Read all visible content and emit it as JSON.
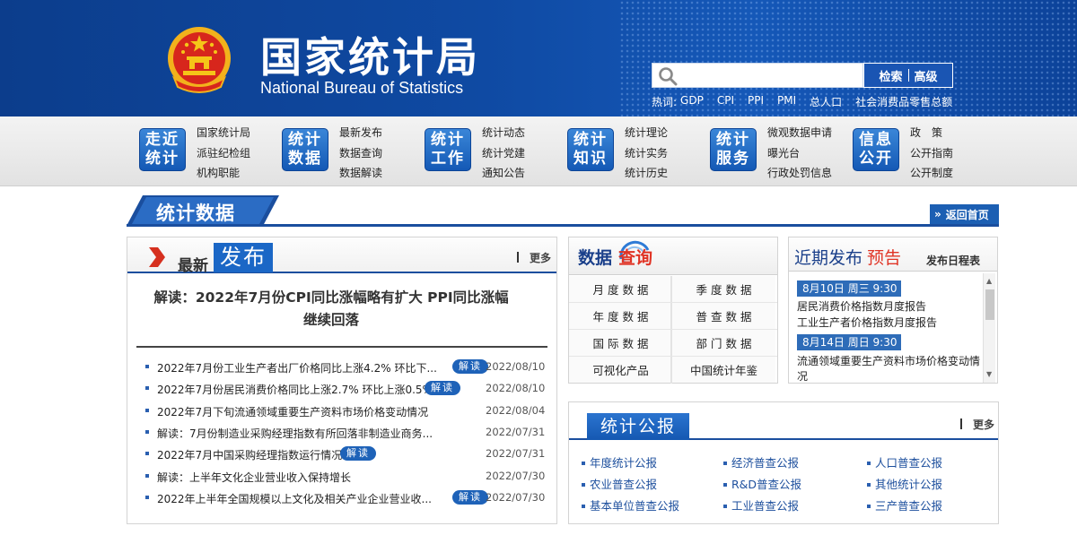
{
  "header": {
    "title": "国家统计局",
    "subtitle": "National Bureau of Statistics",
    "search": {
      "placeholder": "",
      "buttons": [
        "检索",
        "高级"
      ]
    },
    "hot_label": "热词:",
    "hot_words": [
      "GDP",
      "CPI",
      "PPI",
      "PMI",
      "总人口",
      "社会消费品零售总额"
    ]
  },
  "nav": [
    {
      "badge": [
        "走近",
        "统计"
      ],
      "links": [
        "国家统计局",
        "派驻纪检组",
        "机构职能"
      ]
    },
    {
      "badge": [
        "统计",
        "数据"
      ],
      "links": [
        "最新发布",
        "数据查询",
        "数据解读"
      ]
    },
    {
      "badge": [
        "统计",
        "工作"
      ],
      "links": [
        "统计动态",
        "统计党建",
        "通知公告"
      ]
    },
    {
      "badge": [
        "统计",
        "知识"
      ],
      "links": [
        "统计理论",
        "统计实务",
        "统计历史"
      ]
    },
    {
      "badge": [
        "统计",
        "服务"
      ],
      "links": [
        "微观数据申请",
        "曝光台",
        "行政处罚信息"
      ]
    },
    {
      "badge": [
        "信息",
        "公开"
      ],
      "links": [
        "政　策",
        "公开指南",
        "公开制度"
      ]
    }
  ],
  "section": {
    "title": "统计数据",
    "back_home": "返回首页"
  },
  "news": {
    "title_a": "最新",
    "title_b": "发布",
    "more": "更多",
    "headline": "解读：2022年7月份CPI同比涨幅略有扩大 PPI同比涨幅继续回落",
    "tag_label": "解读",
    "items": [
      {
        "text": "2022年7月份工业生产者出厂价格同比上涨4.2% 环比下...",
        "tag": true,
        "date": "2022/08/10"
      },
      {
        "text": "2022年7月份居民消费价格同比上涨2.7% 环比上涨0.5%",
        "tag": true,
        "date": "2022/08/10"
      },
      {
        "text": "2022年7月下旬流通领域重要生产资料市场价格变动情况",
        "tag": false,
        "date": "2022/08/04"
      },
      {
        "text": "解读：7月份制造业采购经理指数有所回落非制造业商务...",
        "tag": false,
        "date": "2022/07/31"
      },
      {
        "text": "2022年7月中国采购经理指数运行情况",
        "tag": true,
        "date": "2022/07/31"
      },
      {
        "text": "解读：上半年文化企业营业收入保持增长",
        "tag": false,
        "date": "2022/07/30"
      },
      {
        "text": "2022年上半年全国规模以上文化及相关产业企业营业收...",
        "tag": true,
        "date": "2022/07/30"
      }
    ]
  },
  "query": {
    "title_a": "数据",
    "title_b": "查询",
    "cells": [
      "月 度 数 据",
      "季 度 数 据",
      "年 度 数 据",
      "普 查 数 据",
      "国 际 数 据",
      "部 门 数 据",
      "可视化产品",
      "中国统计年鉴"
    ]
  },
  "recent": {
    "title_a": "近期发布",
    "title_b": "预告",
    "calendar": "发布日程表",
    "groups": [
      {
        "date": "8月10日  周三  9:30",
        "items": [
          "居民消费价格指数月度报告",
          "工业生产者价格指数月度报告"
        ]
      },
      {
        "date": "8月14日  周日  9:30",
        "items": [
          "流通领域重要生产资料市场价格变动情",
          "况"
        ]
      }
    ]
  },
  "bulletin": {
    "title": "统计公报",
    "more": "更多",
    "items": [
      "年度统计公报",
      "经济普查公报",
      "人口普查公报",
      "农业普查公报",
      "R&D普查公报",
      "其他统计公报",
      "基本单位普查公报",
      "工业普查公报",
      "三产普查公报"
    ]
  },
  "colors": {
    "header_blue": "#0f4aa3",
    "accent_blue": "#1b67c6",
    "accent_red": "#e03324",
    "link_blue": "#1d4f9d"
  }
}
